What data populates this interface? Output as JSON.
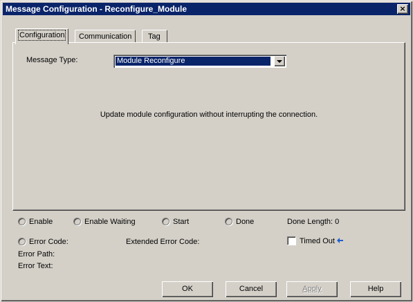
{
  "window": {
    "title": "Message Configuration - Reconfigure_Module",
    "close_label": "×"
  },
  "tabs": [
    {
      "label": "Configuration",
      "active": true
    },
    {
      "label": "Communication",
      "active": false
    },
    {
      "label": "Tag",
      "active": false
    }
  ],
  "configuration": {
    "message_type_label": "Message Type:",
    "message_type_value": "Module Reconfigure",
    "description": "Update module configuration without interrupting the connection."
  },
  "status": {
    "enable": "Enable",
    "enable_waiting": "Enable Waiting",
    "start": "Start",
    "done": "Done",
    "done_length": "Done Length: 0",
    "error_code": "Error Code:",
    "extended_error_code": "Extended Error Code:",
    "timed_out": "Timed Out",
    "error_path": "Error Path:",
    "error_text": "Error Text:"
  },
  "buttons": {
    "ok": "OK",
    "cancel": "Cancel",
    "apply": "Apply",
    "help": "Help"
  },
  "colors": {
    "face": "#d4d0c8",
    "titlebar": "#0a246a",
    "selection": "#0a246a",
    "arrow": "#1f5fd0"
  }
}
